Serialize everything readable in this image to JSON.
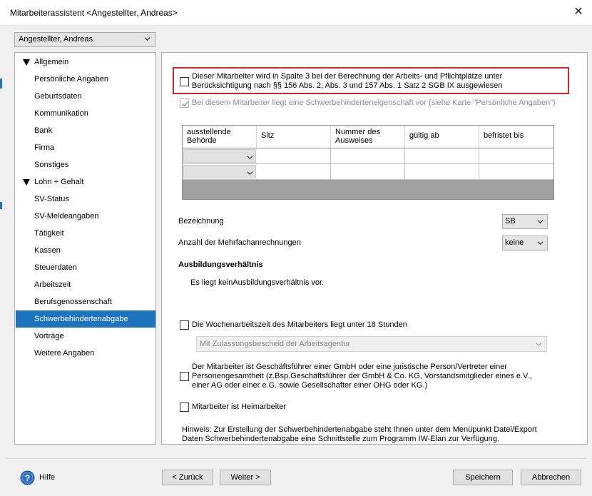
{
  "window": {
    "title": "Mitarbeiterassistent <Angestellter, Andreas>",
    "close_glyph": "✕"
  },
  "employee_select": {
    "value": "Angestellter, Andreas"
  },
  "nav": {
    "groups": [
      {
        "label": "Allgemein",
        "items": [
          "Persönliche Angaben",
          "Geburtsdaten",
          "Kommunikation",
          "Bank",
          "Firma",
          "Sonstiges"
        ]
      },
      {
        "label": "Lohn + Gehalt",
        "items": [
          "SV-Status",
          "SV-Meldeangaben",
          "Tätigkeit",
          "Kassen",
          "Steuerdaten",
          "Arbeitszeit",
          "Berufsgenossenschaft",
          "Schwerbehindertenabgabe",
          "Vorträge",
          "Weitere Angaben"
        ]
      }
    ],
    "selected": "Schwerbehindertenabgabe"
  },
  "content": {
    "spalte3": {
      "line1": "Dieser Mitarbeiter wird in Spalte 3 bei der Berechnung der Arbeits- und Pflichtplätze unter",
      "line2": "Berücksichtigung nach §§ 156 Abs. 2, Abs. 3 und 157 Abs. 1 Satz 2 SGB IX ausgewiesen",
      "checked": false
    },
    "schwerbehindert": {
      "label": "Bei diesem Mitarbeiter liegt eine Schwerbehinderteneigenschaft vor (siehe Karte \"Persönliche Angaben\")",
      "checked": true
    },
    "grid": {
      "headers": [
        [
          "ausstellende",
          "Behörde"
        ],
        [
          "Sitz",
          ""
        ],
        [
          "Nummer des",
          "Ausweises"
        ],
        [
          "gültig ab",
          ""
        ],
        [
          "befristet bis",
          ""
        ]
      ],
      "rows": [
        [
          "",
          "",
          "",
          "",
          ""
        ],
        [
          "",
          "",
          "",
          "",
          ""
        ]
      ]
    },
    "bezeichnung": {
      "label": "Bezeichnung",
      "value": "SB"
    },
    "mehrfach": {
      "label": "Anzahl der Mehrfachanrechnungen",
      "value": "keine"
    },
    "ausbildung": {
      "heading": "Ausbildungsverhältnis",
      "text": "Es liegt keinAusbildungsverhältnis vor."
    },
    "wochenarbeitszeit": {
      "label": "Die Wochenarbeitszeit des Mitarbeiters liegt unter 18 Stunden",
      "checked": false
    },
    "zulassung": {
      "value": "Mit Zulassungsbescheid der Arbeitsagentur"
    },
    "geschaeftsfuehrer": {
      "line1": "Der Mitarbeiter ist Geschäftsführer einer GmbH oder eine juristische Person/Vertreter einer",
      "line2": "Personengesamtheit (z.Bsp.Geschäftsführer der GmbH & Co. KG, Vorstandsmitglieder eines e.V.,",
      "line3": "einer AG oder einer e.G. sowie Gesellschafter einer OHG oder KG.)",
      "checked": false
    },
    "heimarbeiter": {
      "label": "Mitarbeiter ist Heimarbeiter",
      "checked": false
    },
    "hinweis": {
      "line1": "Hinweis: Zur Erstellung der Schwerbehindertenabgabe steht Ihnen unter dem Menüpunkt Datei/Export",
      "line2": "Daten Schwerbehindertenabgabe eine Schnittstelle zum Programm IW-Elan zur Verfügung."
    }
  },
  "footer": {
    "help": "Hilfe",
    "back": "< Zurück",
    "next": "Weiter >",
    "save": "Speichern",
    "cancel": "Abbrechen"
  },
  "colors": {
    "selection": "#1e73be",
    "highlight_border": "#d9262c"
  }
}
